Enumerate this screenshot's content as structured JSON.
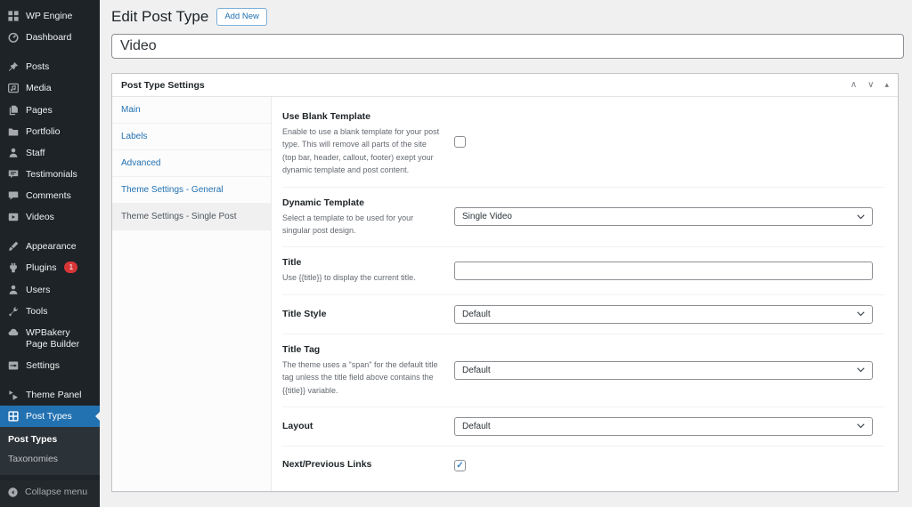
{
  "sidebar": {
    "items": [
      {
        "label": "WP Engine",
        "icon": "wp-engine-icon"
      },
      {
        "label": "Dashboard",
        "icon": "dashboard-icon"
      },
      {
        "label": "Posts",
        "icon": "pin-icon"
      },
      {
        "label": "Media",
        "icon": "media-icon"
      },
      {
        "label": "Pages",
        "icon": "pages-icon"
      },
      {
        "label": "Portfolio",
        "icon": "portfolio-folder-icon"
      },
      {
        "label": "Staff",
        "icon": "person-icon"
      },
      {
        "label": "Testimonials",
        "icon": "testimonial-bubble-icon"
      },
      {
        "label": "Comments",
        "icon": "comment-bubble-icon"
      },
      {
        "label": "Videos",
        "icon": "video-play-icon"
      },
      {
        "label": "Appearance",
        "icon": "paintbrush-icon"
      },
      {
        "label": "Plugins",
        "icon": "plugin-icon",
        "badge": "1"
      },
      {
        "label": "Users",
        "icon": "user-icon"
      },
      {
        "label": "Tools",
        "icon": "wrench-icon"
      },
      {
        "label": "WPBakery Page Builder",
        "icon": "cloud-icon"
      },
      {
        "label": "Settings",
        "icon": "settings-panel-icon"
      },
      {
        "label": "Theme Panel",
        "icon": "theme-panel-icon"
      },
      {
        "label": "Post Types",
        "icon": "grid-window-icon",
        "active": true
      }
    ],
    "submenu": {
      "items": [
        {
          "label": "Post Types",
          "current": true
        },
        {
          "label": "Taxonomies",
          "current": false
        }
      ]
    },
    "collapse_label": "Collapse menu"
  },
  "page": {
    "title": "Edit Post Type",
    "add_new_label": "Add New"
  },
  "title_field": {
    "value": "Video",
    "placeholder": ""
  },
  "metabox": {
    "title": "Post Type Settings",
    "controls": {
      "move_up": "∧",
      "move_down": "∨",
      "toggle": "▴"
    },
    "tabs": [
      {
        "label": "Main",
        "active": false
      },
      {
        "label": "Labels",
        "active": false
      },
      {
        "label": "Advanced",
        "active": false
      },
      {
        "label": "Theme Settings - General",
        "active": false
      },
      {
        "label": "Theme Settings - Single Post",
        "active": true
      }
    ],
    "fields": [
      {
        "label": "Use Blank Template",
        "description": "Enable to use a blank template for your post type. This will remove all parts of the site (top bar, header, callout, footer) exept your dynamic template and post content.",
        "control": "checkbox",
        "checked": false
      },
      {
        "label": "Dynamic Template",
        "description": "Select a template to be used for your singular post design.",
        "control": "select",
        "value": "Single Video"
      },
      {
        "label": "Title",
        "description": "Use {{title}} to display the current title.",
        "control": "text",
        "value": ""
      },
      {
        "label": "Title Style",
        "description": "",
        "control": "select",
        "value": "Default"
      },
      {
        "label": "Title Tag",
        "description": "The theme uses a \"span\" for the default title tag unless the title field above contains the {{title}} variable.",
        "control": "select",
        "value": "Default"
      },
      {
        "label": "Layout",
        "description": "",
        "control": "select",
        "value": "Default"
      },
      {
        "label": "Next/Previous Links",
        "description": "",
        "control": "checkbox",
        "checked": true
      }
    ]
  },
  "colors": {
    "accent": "#2271b1",
    "sidebar_bg": "#1d2327",
    "badge_red": "#d63638",
    "checkmark_blue": "#3582c4",
    "content_bg": "#f0f0f1"
  }
}
